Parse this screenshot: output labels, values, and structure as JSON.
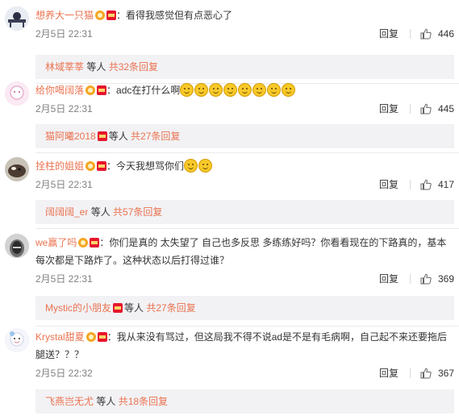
{
  "comments": [
    {
      "username": "想养大一只猫",
      "text": "：看得我感觉但有点恶心了",
      "emoji_count": 0,
      "date": "2月5日 22:31",
      "reply_label": "回复",
      "likes": "446",
      "sub": {
        "user": "林域莘莘",
        "middle": " 等人 ",
        "count": "共32条回复",
        "has_badge": false
      }
    },
    {
      "username": "给你喝阔落",
      "text": "：adc在打什么啊",
      "emoji_count": 8,
      "date": "2月5日 22:31",
      "reply_label": "回复",
      "likes": "445",
      "sub": {
        "user": "猫阿曦2018",
        "middle": "等人 ",
        "count": "共27条回复",
        "has_badge": true
      }
    },
    {
      "username": "拴柱的姐姐",
      "text": "：今天我想骂你们",
      "emoji_count": 2,
      "date": "2月5日 22:31",
      "reply_label": "回复",
      "likes": "417",
      "sub": {
        "user": "阔阔阔_er",
        "middle": " 等人 ",
        "count": "共57条回复",
        "has_badge": false
      }
    },
    {
      "username": "we赢了吗",
      "text": "：你们是真的 太失望了 自己也多反思  多练练好吗？你看看现在的下路真的，基本每次都是下路炸了。这种状态以后打得过谁？",
      "emoji_count": 0,
      "date": "2月5日 22:31",
      "reply_label": "回复",
      "likes": "369",
      "sub": {
        "user": "Mystic的小朋友",
        "middle": "等人 ",
        "count": "共27条回复",
        "has_badge": true
      }
    },
    {
      "username": "Krystal甜夏",
      "text": "：我从来没有骂过，但这局我不得不说ad是不是有毛病啊，自己起不来还要拖后腿送？？？",
      "emoji_count": 0,
      "date": "2月5日 22:32",
      "reply_label": "回复",
      "likes": "367",
      "sub": {
        "user": "飞燕岂无尤",
        "middle": " 等人 ",
        "count": "共18条回复",
        "has_badge": false
      }
    }
  ],
  "icons": {
    "like": "thumbs-up-icon",
    "vip": "vip-badge-icon",
    "red": "red-envelope-badge-icon"
  },
  "colors": {
    "username": "#eb7350",
    "meta": "#808080",
    "sub_bg": "#f2f2f5"
  }
}
